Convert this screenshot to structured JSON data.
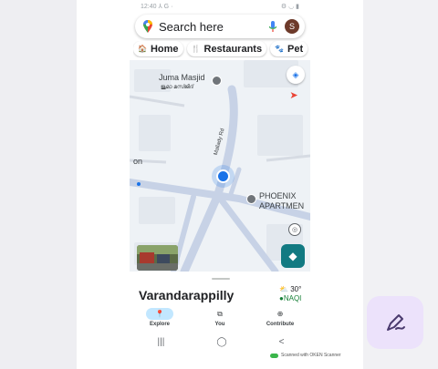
{
  "status": {
    "time": "12:40 ⅄ G ·",
    "icons": "⚙ ◡ ▮"
  },
  "search": {
    "placeholder": "Search here",
    "avatar_letter": "S"
  },
  "chips": [
    {
      "icon": "🏠",
      "label": "Home"
    },
    {
      "icon": "🍴",
      "label": "Restaurants"
    },
    {
      "icon": "🐾",
      "label": "Pet"
    }
  ],
  "map": {
    "labels": {
      "masjid": "Juma Masjid",
      "masjid_local": "ജുമാ മസ്ജിദ്",
      "on": "on",
      "phoenix_1": "PHOENIX",
      "phoenix_2": "APARTMEN",
      "road": "Mallady Rd"
    }
  },
  "place": {
    "title": "Varandarappilly",
    "temp": "30°",
    "aqi": "●NAQI"
  },
  "nav": {
    "explore": "Explore",
    "you": "You",
    "contribute": "Contribute"
  },
  "sysnav": {
    "recent": "|||",
    "home": "◯",
    "back": "<"
  },
  "scanner": "Scanned with OKEN Scanner",
  "colors": {
    "accent": "#127a82",
    "fab_bg": "#ece2fb",
    "location_dot": "#1a73e8"
  }
}
